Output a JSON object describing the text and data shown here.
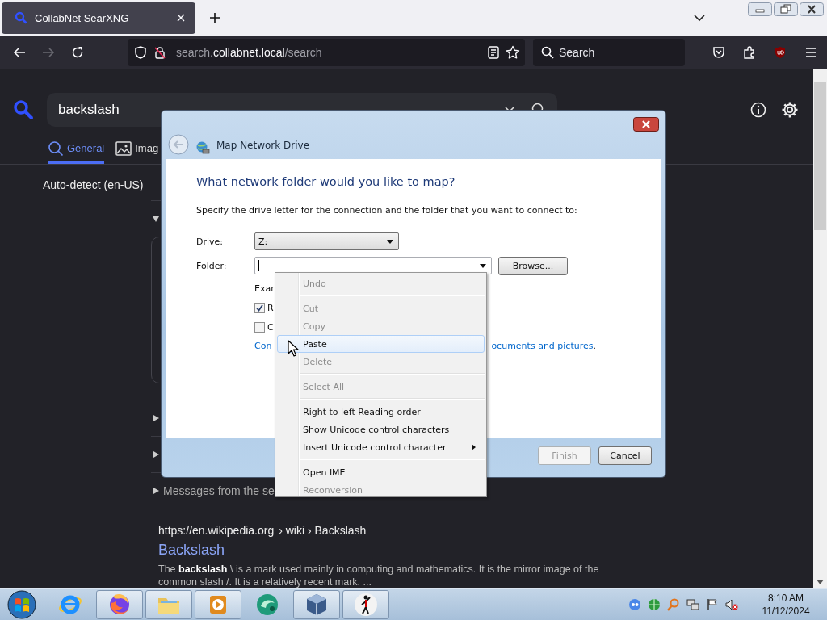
{
  "browser_tab": {
    "title": "CollabNet SearXNG",
    "selected": true
  },
  "toolbar": {
    "url": {
      "host_prefix": "search.",
      "domain": "collabnet.local",
      "path": "/search"
    },
    "search_placeholder": "Search",
    "forward_disabled": true
  },
  "page": {
    "query": "backslash",
    "categories": [
      {
        "label": "General",
        "selected": true
      },
      {
        "label": "Imag",
        "selected": false
      }
    ],
    "language": "Auto-detect (en-US)",
    "sections": [
      {
        "expanded": true
      },
      {
        "expanded": false
      },
      {
        "expanded": false
      },
      {
        "label": "Messages from the se",
        "expanded": false
      }
    ],
    "result": {
      "url": "https://en.wikipedia.org",
      "path": "› wiki › Backslash",
      "title": "Backslash",
      "snippet": "The **backslash** \\ is a mark used mainly in computing and mathematics. It is the mirror image of the common slash /. It is a relatively recent mark. ..."
    }
  },
  "dialog": {
    "title": "Map Network Drive",
    "heading": "What network folder would you like to map?",
    "description": "Specify the drive letter for the connection and the folder that you want to connect to:",
    "drive_label": "Drive:",
    "drive_value": "Z:",
    "folder_label": "Folder:",
    "browse_button": "Browse...",
    "example": "Exan",
    "checkboxes": [
      {
        "label": "R",
        "checked": true
      },
      {
        "label": "C",
        "checked": false
      }
    ],
    "link_start": "Con",
    "link_end": "ocuments and pictures",
    "link_period": ".",
    "buttons": [
      {
        "label": "Finish",
        "disabled": true
      },
      {
        "label": "Cancel",
        "disabled": false
      }
    ]
  },
  "context_menu": {
    "items": [
      {
        "kind": "item",
        "label": "Undo",
        "disabled": true,
        "selected": false
      },
      {
        "kind": "separator"
      },
      {
        "kind": "item",
        "label": "Cut",
        "disabled": true,
        "selected": false
      },
      {
        "kind": "item",
        "label": "Copy",
        "disabled": true,
        "selected": false
      },
      {
        "kind": "item",
        "label": "Paste",
        "disabled": false,
        "selected": true
      },
      {
        "kind": "item",
        "label": "Delete",
        "disabled": true,
        "selected": false
      },
      {
        "kind": "separator"
      },
      {
        "kind": "item",
        "label": "Select All",
        "disabled": true,
        "selected": false
      },
      {
        "kind": "separator"
      },
      {
        "kind": "item",
        "label": "Right to left Reading order",
        "disabled": false,
        "selected": false
      },
      {
        "kind": "item",
        "label": "Show Unicode control characters",
        "disabled": false,
        "selected": false
      },
      {
        "kind": "submenu",
        "label": "Insert Unicode control character",
        "disabled": false,
        "selected": false
      },
      {
        "kind": "separator"
      },
      {
        "kind": "item",
        "label": "Open IME",
        "disabled": false,
        "selected": false
      },
      {
        "kind": "item",
        "label": "Reconversion",
        "disabled": true,
        "selected": false
      }
    ]
  },
  "taskbar": {
    "apps": [
      {
        "kind": "ie",
        "running": false
      },
      {
        "kind": "firefox",
        "running": true
      },
      {
        "kind": "explorer",
        "running": true
      },
      {
        "kind": "media",
        "running": true
      },
      {
        "kind": "green",
        "running": false
      },
      {
        "kind": "vbox",
        "running": true
      },
      {
        "kind": "figure",
        "running": true
      }
    ],
    "time": "8:10 AM",
    "date": "11/12/2024"
  }
}
